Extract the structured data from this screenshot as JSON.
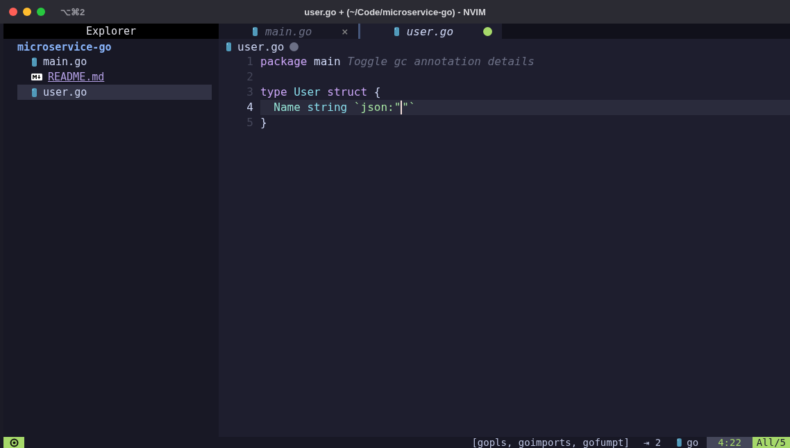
{
  "window": {
    "title": "user.go + (~/Code/microservice-go) - NVIM",
    "shortcut": "⌥⌘2"
  },
  "explorer": {
    "title": "Explorer",
    "root": "microservice-go",
    "items": [
      {
        "label": "main.go",
        "kind": "go",
        "selected": false
      },
      {
        "label": "README.md",
        "kind": "markdown",
        "selected": false
      },
      {
        "label": "user.go",
        "kind": "go",
        "selected": true
      }
    ]
  },
  "tabs": [
    {
      "label": "main.go",
      "selected": false,
      "modified": false,
      "close": "×"
    },
    {
      "label": "user.go",
      "selected": true,
      "modified": true
    }
  ],
  "winbar": {
    "file": "user.go",
    "modified": true
  },
  "lines": [
    {
      "number": "1",
      "current": false,
      "tokens": [
        {
          "text": "package",
          "kind": "keyword"
        },
        {
          "text": " main",
          "kind": "plain"
        },
        {
          "text": " Toggle gc annotation details",
          "kind": "hint"
        }
      ]
    },
    {
      "number": "2",
      "current": false
    },
    {
      "number": "3",
      "current": false,
      "tokens": [
        {
          "text": "type",
          "kind": "keyword"
        },
        {
          "text": " User",
          "kind": "type"
        },
        {
          "text": " struct",
          "kind": "keyword"
        },
        {
          "text": " {",
          "kind": "plain"
        }
      ]
    },
    {
      "number": "4",
      "current": true,
      "tokens": [
        {
          "text": "  Name",
          "kind": "field"
        },
        {
          "text": " string",
          "kind": "type"
        },
        {
          "text": " `json:\"",
          "kind": "string"
        },
        {
          "kind": "cursor"
        },
        {
          "text": "\"`",
          "kind": "string"
        }
      ]
    },
    {
      "number": "5",
      "current": false,
      "tokens": [
        {
          "text": "}",
          "kind": "plain"
        }
      ]
    }
  ],
  "status_bar": {
    "insert_mode": true,
    "formatters": "[gopls, goimports, gofumpt]",
    "indent": "⇥ 2",
    "filetype": "go",
    "position": "4:22",
    "progress": "All/5"
  }
}
